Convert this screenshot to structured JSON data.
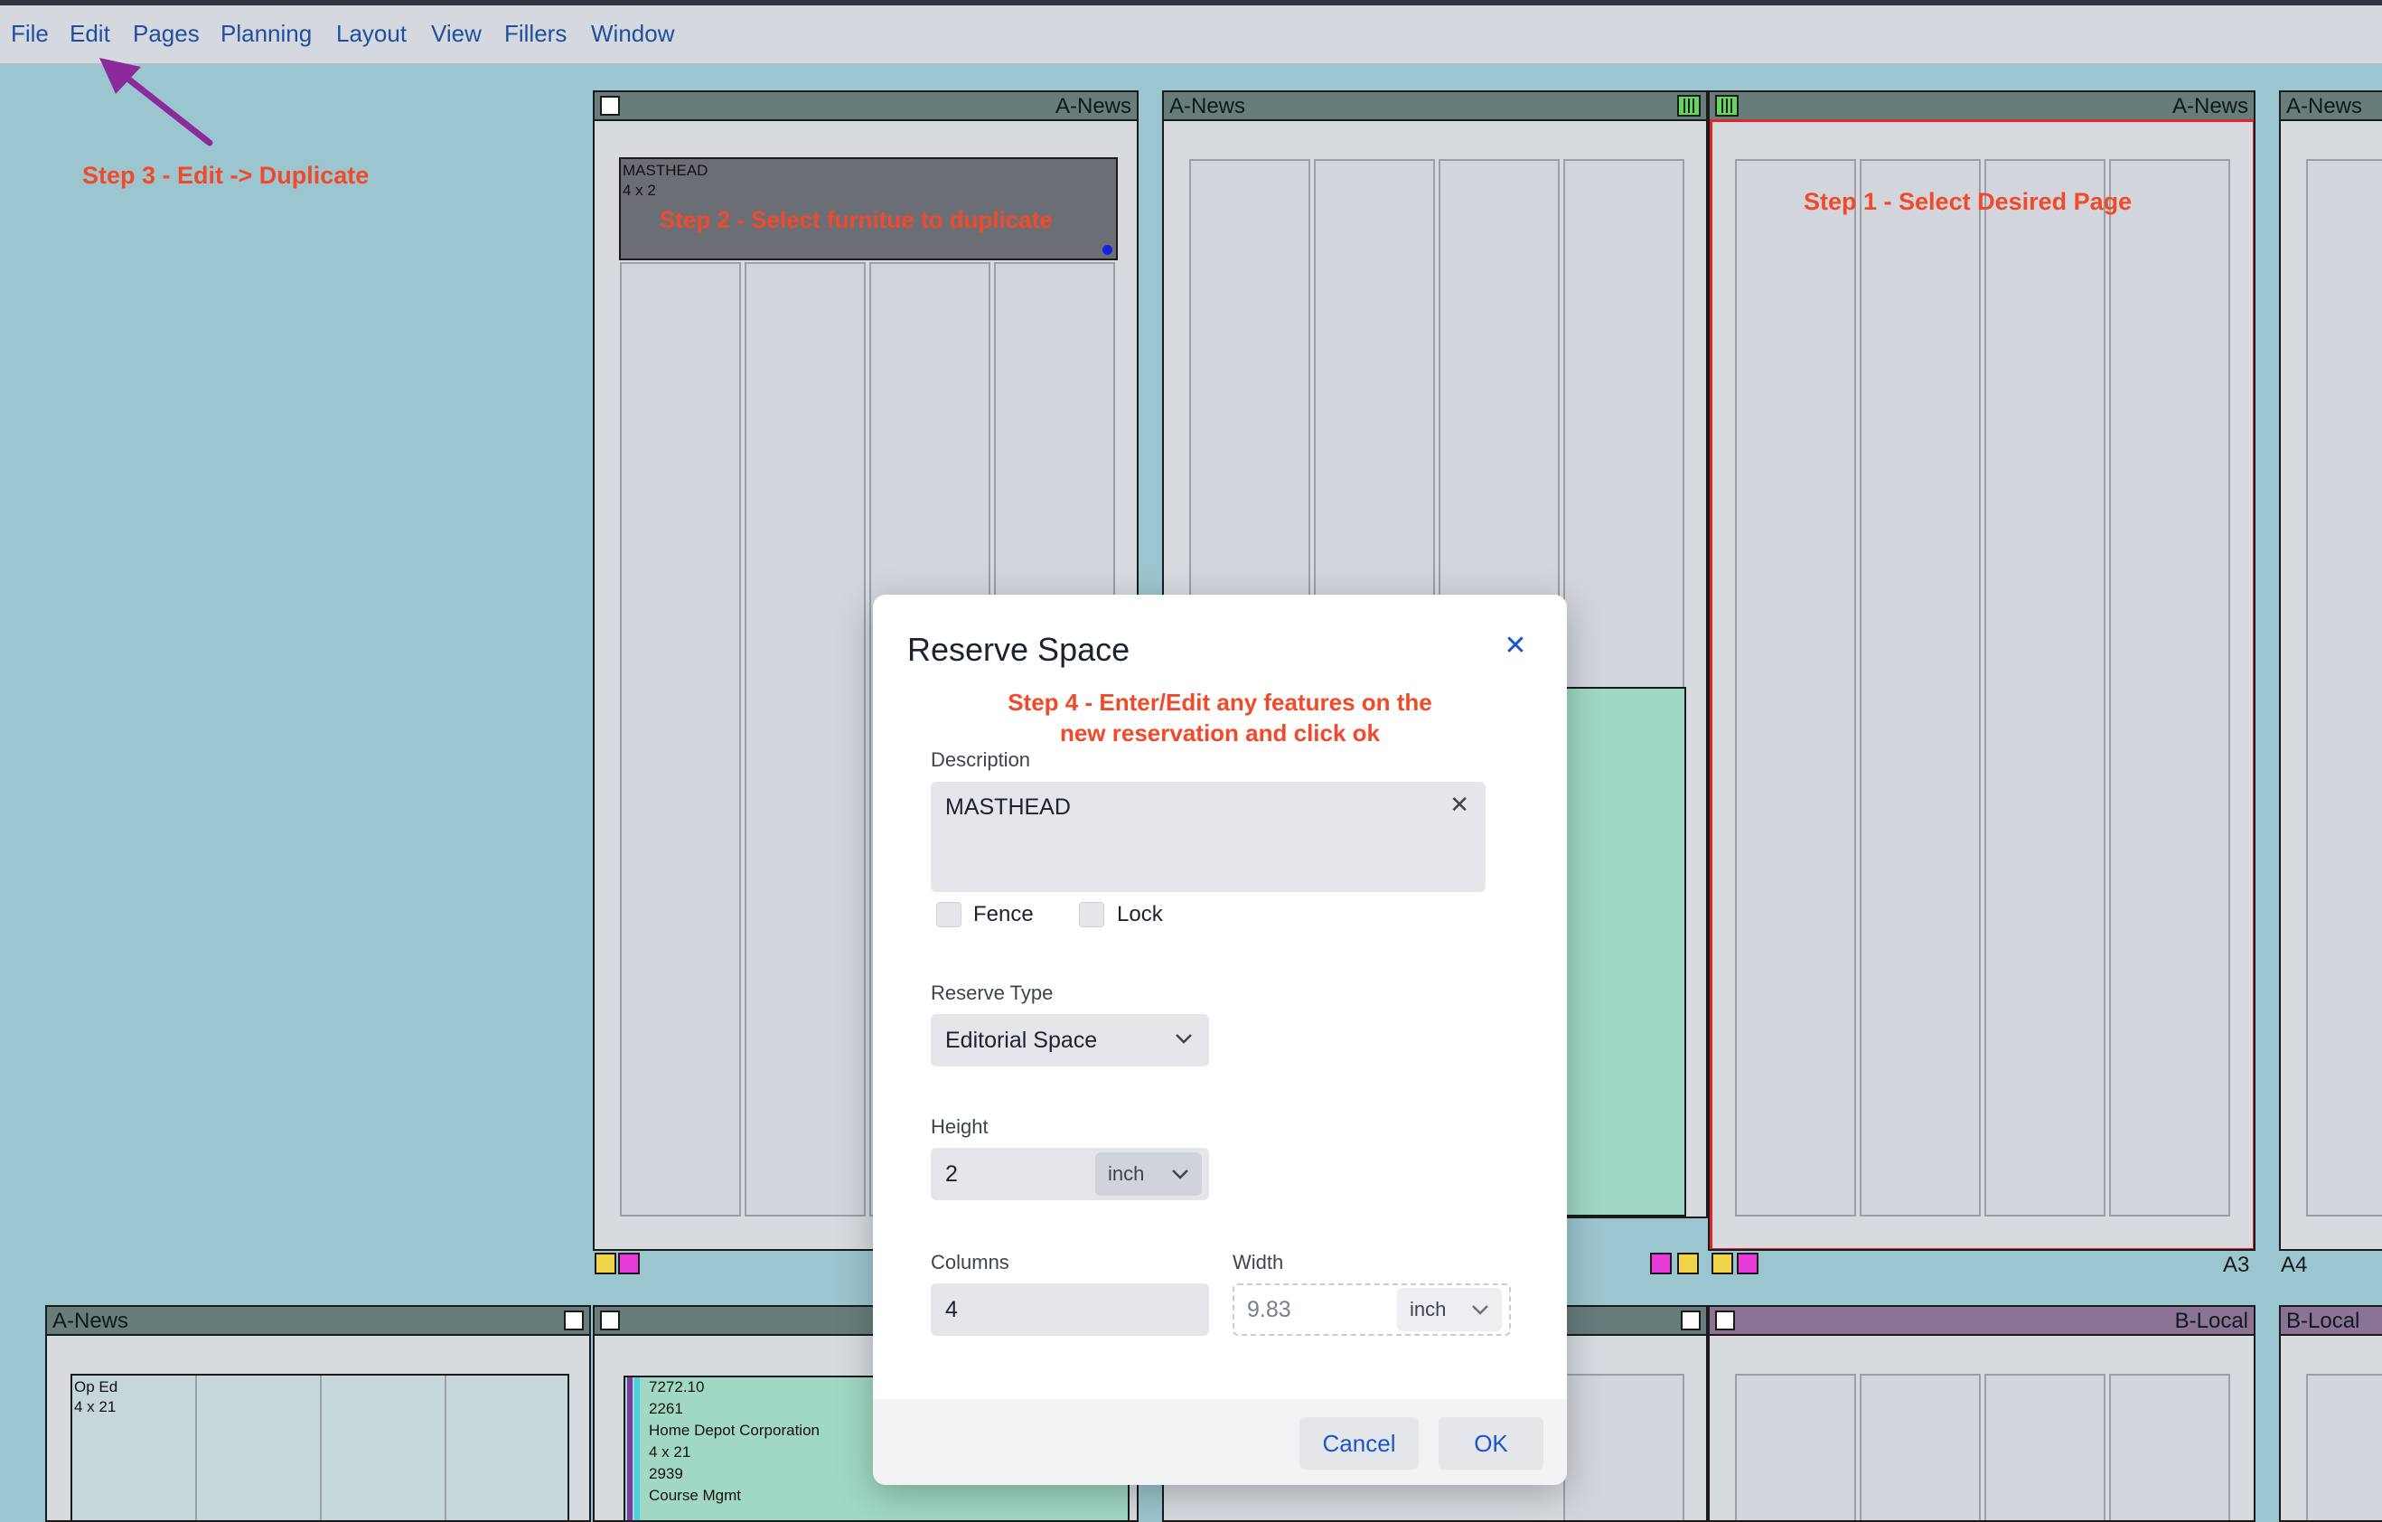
{
  "menu": {
    "file": "File",
    "edit": "Edit",
    "pages": "Pages",
    "planning": "Planning",
    "layout": "Layout",
    "view": "View",
    "fillers": "Fillers",
    "window": "Window"
  },
  "annotations": {
    "step1": "Step 1 - Select Desired Page",
    "step2": "Step 2 - Select furnitue to duplicate",
    "step3": "Step 3 - Edit -> Duplicate",
    "step4_line1": "Step 4 - Enter/Edit any features on the",
    "step4_line2": "new reservation and click ok",
    "arrow_color": "#8b2a9a",
    "annotation_color": "#f04a2a"
  },
  "pages": {
    "p1_section": "A-News",
    "p2_section": "A-News",
    "p3_section": "A-News",
    "p4_section": "A-News",
    "p3_number": "A3",
    "p4_number": "A4",
    "r2_p1_section": "A-News",
    "r2_p4_section": "B-Local",
    "r2_p5_section": "B-Local"
  },
  "furniture": {
    "masthead_name": "MASTHEAD",
    "masthead_size": "4 x 2",
    "oped_name": "Op Ed",
    "oped_size": "4 x 21",
    "ad_lines": [
      "7272.10",
      "2261",
      "Home Depot Corporation",
      "4 x 21",
      "2939",
      "Course Mgmt"
    ]
  },
  "dialog": {
    "title": "Reserve Space",
    "description_label": "Description",
    "description_value": "MASTHEAD",
    "fence_label": "Fence",
    "lock_label": "Lock",
    "reserve_type_label": "Reserve Type",
    "reserve_type_value": "Editorial Space",
    "height_label": "Height",
    "height_value": "2",
    "height_unit": "inch",
    "columns_label": "Columns",
    "columns_value": "4",
    "width_label": "Width",
    "width_value": "9.83",
    "width_unit": "inch",
    "cancel_label": "Cancel",
    "ok_label": "OK"
  },
  "colors": {
    "canvas": "#9cc6cf",
    "page_header": "#667d7c",
    "local_header": "#8a7394",
    "furniture_dark": "#6b6f75",
    "ad_green": "#a0d8c3",
    "selection_red": "#e0262a",
    "accent_blue": "#1a56c9"
  }
}
